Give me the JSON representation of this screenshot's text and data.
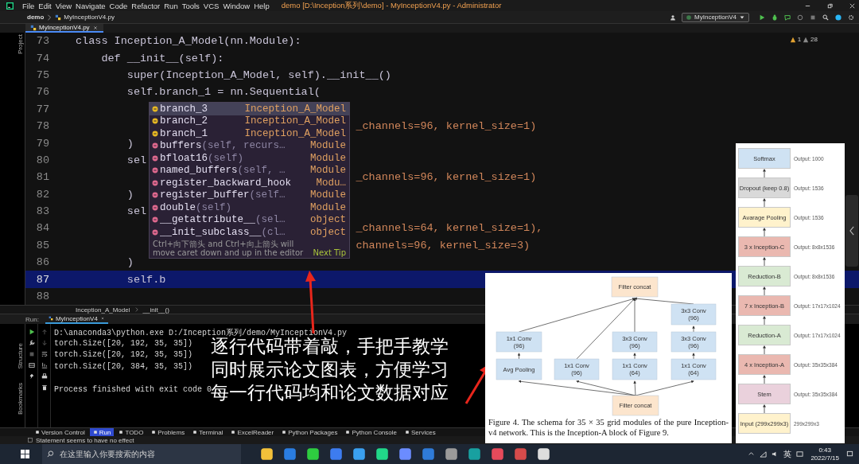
{
  "title_bar": {
    "menus": [
      "File",
      "Edit",
      "View",
      "Navigate",
      "Code",
      "Refactor",
      "Run",
      "Tools",
      "VCS",
      "Window",
      "Help"
    ],
    "title": "demo [D:\\Inception系列\\demo] - MyInceptionV4.py - Administrator"
  },
  "nav_bar": {
    "breadcrumbs": [
      "demo",
      "MyInceptionV4.py"
    ],
    "run_config": "MyInceptionV4"
  },
  "editor_tabs": [
    {
      "label": "MyInceptionV4.py",
      "selected": true
    }
  ],
  "left_strip": {
    "top": [
      "Project"
    ],
    "bottom": [
      "Structure",
      "Bookmarks"
    ]
  },
  "inspections": {
    "warnings": "1",
    "weak_warnings": "28"
  },
  "editor": {
    "lines": [
      {
        "number": "73",
        "code": "class Inception_A_Model(nn.Module):",
        "current": false
      },
      {
        "number": "74",
        "code": "    def __init__(self):",
        "current": false
      },
      {
        "number": "75",
        "code": "        super(Inception_A_Model, self).__init__()",
        "current": false
      },
      {
        "number": "76",
        "code": "        self.branch_1 = nn.Sequential(",
        "current": false
      },
      {
        "number": "77",
        "current": false
      },
      {
        "number": "78",
        "tail": "_channels=96, kernel_size=1)",
        "current": false
      },
      {
        "number": "79",
        "code": "        )",
        "current": false
      },
      {
        "number": "80",
        "code": "        sel",
        "current": false
      },
      {
        "number": "81",
        "tail": "_channels=96, kernel_size=1)",
        "current": false
      },
      {
        "number": "82",
        "code": "        )",
        "current": false
      },
      {
        "number": "83",
        "code": "        sel",
        "current": false
      },
      {
        "number": "84",
        "tail": "_channels=64, kernel_size=1),",
        "current": false
      },
      {
        "number": "85",
        "tail": "channels=96, kernel_size=3)",
        "current": false
      },
      {
        "number": "86",
        "code": "        )",
        "current": false
      },
      {
        "number": "87",
        "code": "        self.b",
        "current": true
      },
      {
        "number": "88",
        "current": false
      }
    ]
  },
  "completion_popup": {
    "items": [
      {
        "kind": "field",
        "name": "branch_3",
        "type": "Inception_A_Model",
        "selected": true
      },
      {
        "kind": "field",
        "name": "branch_2",
        "type": "Inception_A_Model",
        "selected": false
      },
      {
        "kind": "field",
        "name": "branch_1",
        "type": "Inception_A_Model",
        "selected": false
      },
      {
        "kind": "method",
        "name": "buffers",
        "params": "(self, recurs…",
        "type": "Module",
        "selected": false
      },
      {
        "kind": "method",
        "name": "bfloat16",
        "params": "(self)",
        "type": "Module",
        "selected": false
      },
      {
        "kind": "method",
        "name": "named_buffers",
        "params": "(self, …",
        "type": "Module",
        "selected": false
      },
      {
        "kind": "method",
        "name": "register_backward_hook",
        "type": "Modu…",
        "selected": false
      },
      {
        "kind": "method",
        "name": "register_buffer",
        "params": "(self…",
        "type": "Module",
        "selected": false
      },
      {
        "kind": "method",
        "name": "double",
        "params": "(self)",
        "type": "Module",
        "selected": false
      },
      {
        "kind": "method",
        "name": "__getattribute__",
        "params": "(sel…",
        "type": "object",
        "selected": false
      },
      {
        "kind": "method",
        "name": "__init_subclass__",
        "params": "(cl…",
        "type": "object",
        "selected": false
      }
    ],
    "hint": "Ctrl+向下箭头 and Ctrl+向上箭头 will move caret down and up in the editor",
    "hint_link": "Next Tip"
  },
  "breadcrumb": [
    "Inception_A_Model",
    "__init__()"
  ],
  "run_panel": {
    "label": "Run:",
    "tab": {
      "label": "MyInceptionV4",
      "selected": true
    },
    "output": [
      "D:\\anaconda3\\python.exe D:/Inception系列/demo/MyInceptionV4.py",
      "torch.Size([20, 192, 35, 35])",
      "torch.Size([20, 192, 35, 35])",
      "torch.Size([20, 384, 35, 35])",
      "Process finished with exit code 0"
    ]
  },
  "tool_windows": [
    {
      "label": "Version Control",
      "selected": false
    },
    {
      "label": "Run",
      "selected": true
    },
    {
      "label": "TODO",
      "selected": false
    },
    {
      "label": "Problems",
      "selected": false
    },
    {
      "label": "Terminal",
      "selected": false
    },
    {
      "label": "ExcelReader",
      "selected": false
    },
    {
      "label": "Python Packages",
      "selected": false
    },
    {
      "label": "Python Console",
      "selected": false
    },
    {
      "label": "Services",
      "selected": false
    }
  ],
  "status_bar": {
    "message": "Statement seems to have no effect"
  },
  "subtitle": [
    "逐行代码带着敲，手把手教学",
    "同时展示论文图表，方便学习",
    "每一行代码均和论文数据对应"
  ],
  "figure": {
    "nodes": [
      {
        "label": "Filter concat",
        "color": "#fce5cd"
      },
      {
        "label": "1x1 Conv",
        "detail": "(96)",
        "color": "#cfe2f3"
      },
      {
        "label": "Avg Pooling",
        "color": "#cfe2f3"
      },
      {
        "label": "1x1 Conv",
        "detail": "(96)",
        "color": "#cfe2f3"
      },
      {
        "label": "3x3 Conv",
        "detail": "(96)",
        "color": "#cfe2f3"
      },
      {
        "label": "1x1 Conv",
        "detail": "(64)",
        "color": "#cfe2f3"
      },
      {
        "label": "3x3 Conv",
        "detail": "(96)",
        "color": "#cfe2f3"
      },
      {
        "label": "3x3 Conv",
        "detail": "(96)",
        "color": "#cfe2f3"
      },
      {
        "label": "1x1 Conv",
        "detail": "(64)",
        "color": "#cfe2f3"
      },
      {
        "label": "Filter concat",
        "color": "#fce5cd"
      }
    ],
    "caption": "Figure 4. The schema for 35 × 35 grid modules of the pure Inception-v4 network. This is the Inception-A block of Figure 9."
  },
  "architecture": {
    "blocks": [
      {
        "label": "Softmax",
        "output": "Output: 1000",
        "color": "#cfe2f3"
      },
      {
        "label": "Dropout (keep 0.8)",
        "output": "Output: 1536",
        "color": "#d9d9d9"
      },
      {
        "label": "Avarage Pooling",
        "output": "Output: 1536",
        "color": "#fff2cc"
      },
      {
        "label": "3 x Inception-C",
        "output": "Output: 8x8x1536",
        "color": "#eab8b0"
      },
      {
        "label": "Reduction-B",
        "output": "Output: 8x8x1536",
        "color": "#d9ead3"
      },
      {
        "label": "7 x Inception-B",
        "output": "Output: 17x17x1024",
        "color": "#eab8b0"
      },
      {
        "label": "Reduction-A",
        "output": "Output: 17x17x1024",
        "color": "#d9ead3"
      },
      {
        "label": "4 x Inception-A",
        "output": "Output: 35x35x384",
        "color": "#eab8b0"
      },
      {
        "label": "Stem",
        "output": "Output: 35x35x384",
        "color": "#ead1dc"
      },
      {
        "label": "Input (299x299x3)",
        "output": "299x299x3",
        "color": "#fff2cc"
      }
    ]
  },
  "taskbar": {
    "search": {
      "placeholder": "在这里输入你要搜索的内容"
    },
    "ime": "英",
    "time": "0:43",
    "date": "2022/7/15"
  }
}
